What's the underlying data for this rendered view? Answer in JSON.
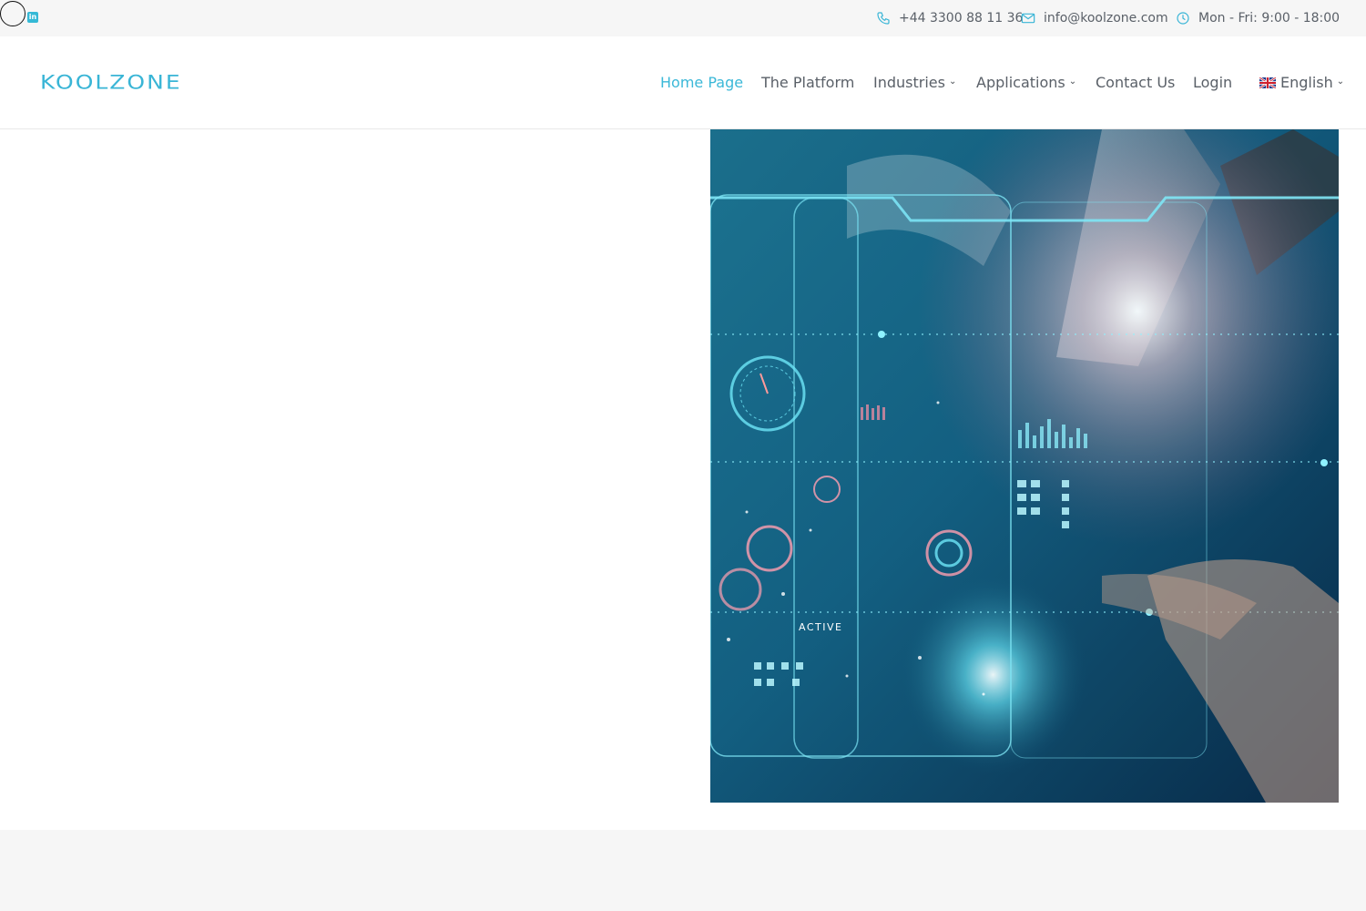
{
  "topbar": {
    "linkedin_label": "in",
    "phone": "+44 3300 88 11 36",
    "email": "info@koolzone.com",
    "hours": "Mon - Fri: 9:00 - 18:00"
  },
  "header": {
    "logo_text": "KOOLZONE",
    "nav": {
      "home": "Home Page",
      "platform": "The Platform",
      "industries": "Industries",
      "applications": "Applications",
      "contact": "Contact Us",
      "login": "Login",
      "language": "English"
    }
  },
  "hero": {
    "overlay_text": "ACTIVE"
  },
  "colors": {
    "accent": "#3bb8d8",
    "topbar_bg": "#f6f6f6",
    "nav_text": "#5a6068"
  },
  "icons": [
    "linkedin-icon",
    "phone-icon",
    "mail-icon",
    "clock-icon",
    "chevron-down-icon",
    "uk-flag-icon"
  ]
}
